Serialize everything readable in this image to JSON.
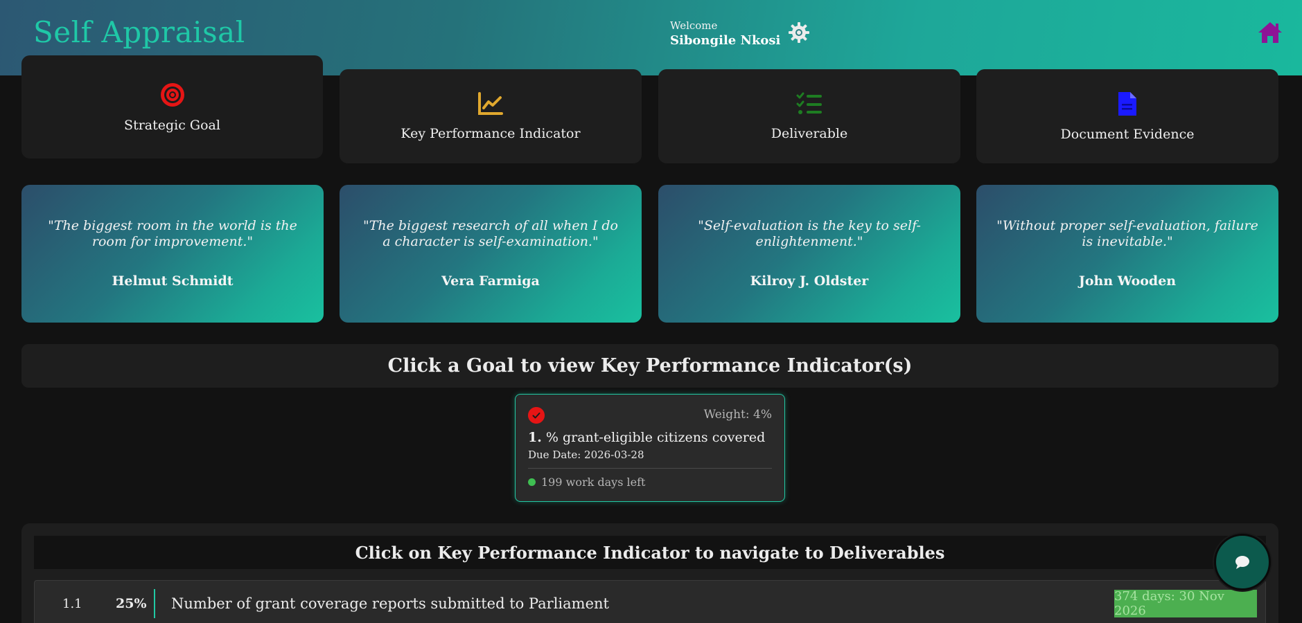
{
  "header": {
    "title": "Self Appraisal",
    "welcome_label": "Welcome",
    "user_name": "Sibongile Nkosi",
    "icons": [
      "gear-icon",
      "home-icon"
    ]
  },
  "nav_cards": {
    "strategic_goal": "Strategic Goal",
    "kpi": "Key Performance Indicator",
    "deliverable": "Deliverable",
    "document_evidence": "Document Evidence"
  },
  "quotes": [
    {
      "text": "\"The biggest room in the world is the room for improvement.\"",
      "author": "Helmut Schmidt"
    },
    {
      "text": "\"The biggest research of all when I do a character is self-examination.\"",
      "author": "Vera Farmiga"
    },
    {
      "text": "\"Self-evaluation is the key to self-enlightenment.\"",
      "author": "Kilroy J. Oldster"
    },
    {
      "text": "\"Without proper self-evaluation, failure is inevitable.\"",
      "author": "John Wooden"
    }
  ],
  "goals_banner": "Click a Goal to view Key Performance Indicator(s)",
  "goal": {
    "weight": "Weight: 4%",
    "number": "1.",
    "title": "% grant-eligible citizens covered",
    "due": "Due Date: 2026-03-28",
    "status": "199 work days left"
  },
  "kpi_section": {
    "heading": "Click on Key Performance Indicator to navigate to Deliverables",
    "rows": [
      {
        "number": "1.1",
        "percent": "25%",
        "title": "Number of grant coverage reports submitted to Parliament",
        "badge": "374 days: 30 Nov 2026"
      }
    ]
  },
  "colors": {
    "accent": "#21c9a4",
    "strategic_icon": "#e51515",
    "kpi_icon": "#e0a82e",
    "deliverable_icon": "#1e7d22",
    "document_icon": "#1a1aff",
    "home_icon": "#8e1396",
    "badge": "#4caf50"
  }
}
